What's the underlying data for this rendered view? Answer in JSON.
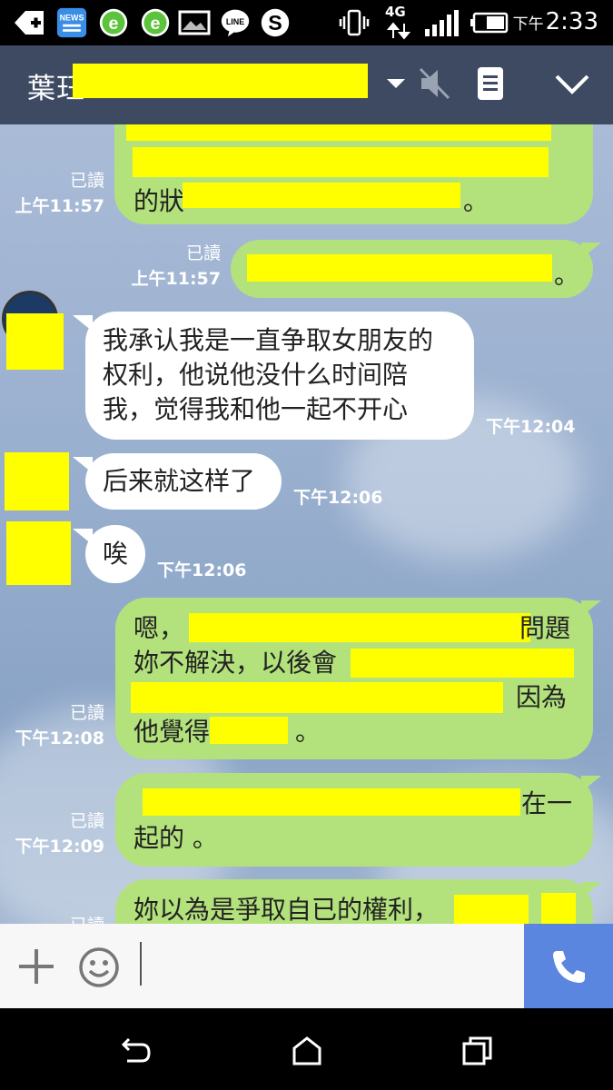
{
  "status_bar": {
    "time_prefix": "下午",
    "time": "2:33",
    "network": "4G"
  },
  "header": {
    "contact_name": "葉珏"
  },
  "messages": [
    {
      "direction": "outgoing",
      "lines": [
        "的狀",
        "。"
      ],
      "read": "已讀",
      "time": "上午11:57"
    },
    {
      "direction": "outgoing",
      "lines": [
        "。"
      ],
      "read": "已讀",
      "time": "上午11:57"
    },
    {
      "direction": "incoming",
      "lines": [
        "我承认我是一直争取女朋友的",
        "权利，他说他没什么时间陪",
        "我，觉得我和他一起不开心"
      ],
      "time": "下午12:04"
    },
    {
      "direction": "incoming",
      "lines": [
        "后来就这样了"
      ],
      "time": "下午12:06"
    },
    {
      "direction": "incoming",
      "lines": [
        "唉"
      ],
      "time": "下午12:06"
    },
    {
      "direction": "outgoing",
      "lines": [
        "嗯，",
        "問題",
        "妳不解決，以後會",
        "因為",
        "他覺得",
        "。"
      ],
      "read": "已讀",
      "time": "下午12:08"
    },
    {
      "direction": "outgoing",
      "lines": [
        "在一",
        "起的 。"
      ],
      "read": "已讀",
      "time": "下午12:09"
    },
    {
      "direction": "outgoing",
      "lines": [
        "妳以為是爭取自已的權利，"
      ],
      "read": "已讀",
      "time": ""
    }
  ],
  "colors": {
    "header_bg": "#3d4a62",
    "outgoing_bubble": "#b3e27c",
    "incoming_bubble": "#ffffff",
    "call_button": "#5b86e0",
    "redaction": "#ffff00"
  },
  "icons": {
    "header": [
      "chevron-down-icon",
      "mute-icon",
      "notes-icon",
      "collapse-icon"
    ],
    "input": [
      "plus-icon",
      "emoji-icon",
      "phone-icon"
    ],
    "nav": [
      "back-icon",
      "home-icon",
      "recents-icon"
    ]
  }
}
